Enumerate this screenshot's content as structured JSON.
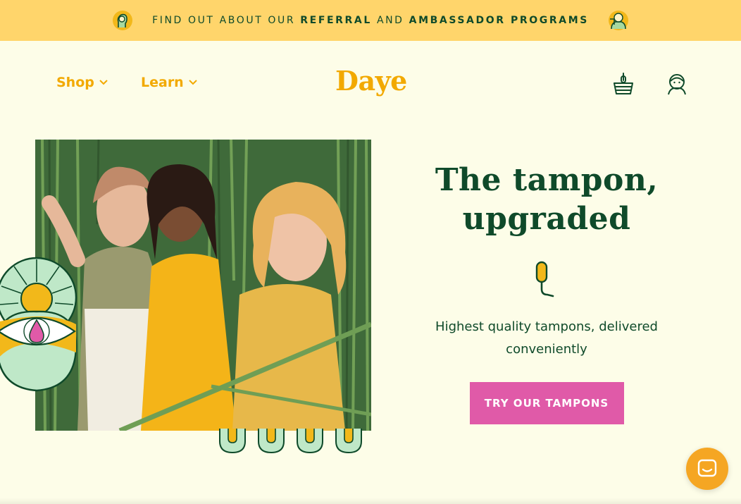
{
  "promo_bar": {
    "text_1": "Find out about our",
    "text_2": "Referral",
    "text_3": "and",
    "text_4": "Ambassador Programs",
    "bg_color": "#ffd56b",
    "left_icon": "lightbulb-hand-icon",
    "right_icon": "ambassador-icon"
  },
  "nav": {
    "shop_label": "Shop",
    "learn_label": "Learn",
    "logo_text": "Daye",
    "cart_icon": "basket-icon",
    "account_icon": "account-avatar-icon",
    "accent_color": "#f2a900"
  },
  "hero": {
    "title_line1": "The tampon,",
    "title_line2": "upgraded",
    "subtitle": "Highest quality tampons, delivered conveniently",
    "cta_label": "Try our tampons",
    "cta_color": "#e05aa8",
    "text_color": "#0f4a2a"
  },
  "chat": {
    "icon": "chat-icon"
  }
}
